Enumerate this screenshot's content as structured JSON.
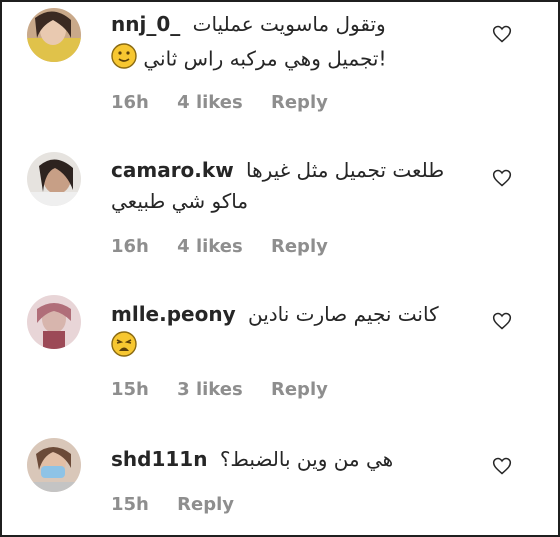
{
  "comments": [
    {
      "username": "nnj_0_",
      "text_line1": "وتقول ماسويت عمليات",
      "text_line2": "!تجميل وهي مركبه راس ثاني",
      "emoji": "slightly-smiling-face",
      "time": "16h",
      "likes": "4 likes",
      "reply": "Reply"
    },
    {
      "username": "camaro.kw",
      "text_line1": "طلعت تجميل مثل غيرها",
      "text_line2": "ماكو شي طبيعي",
      "time": "16h",
      "likes": "4 likes",
      "reply": "Reply"
    },
    {
      "username": "mlle.peony",
      "text_line1": "كانت نجيم صارت نادين",
      "emoji": "tired-face",
      "time": "15h",
      "likes": "3 likes",
      "reply": "Reply"
    },
    {
      "username": "shd111n",
      "text_line1": "هي من وين بالضبط؟",
      "time": "15h",
      "reply": "Reply"
    }
  ],
  "colors": {
    "text": "#262626",
    "meta": "#8e8e8e",
    "emoji_yellow": "#f7c731"
  }
}
